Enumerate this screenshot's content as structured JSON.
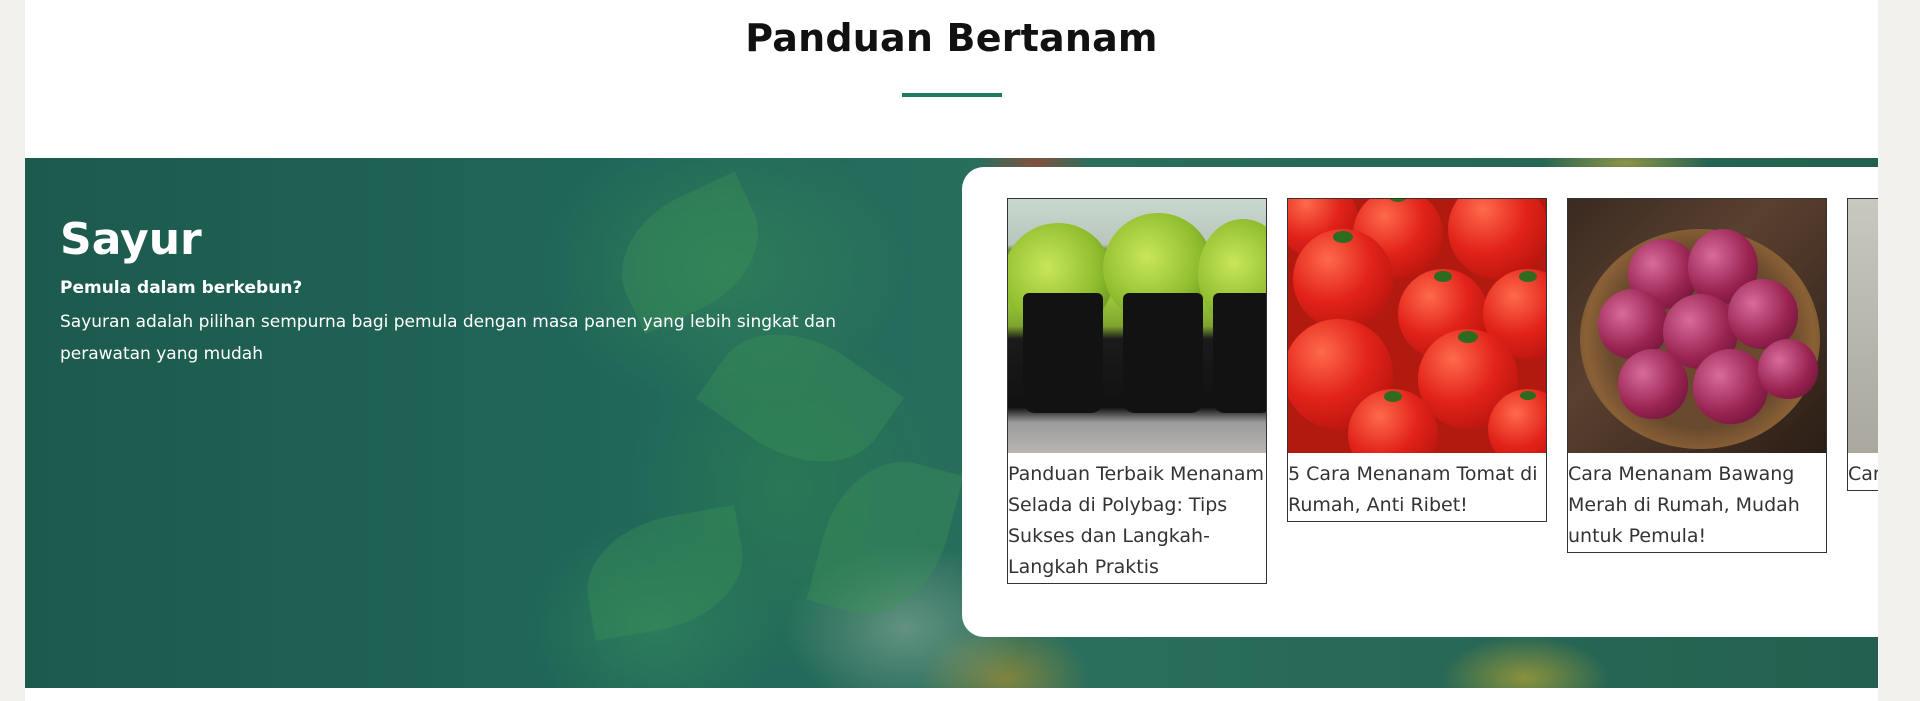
{
  "section": {
    "title": "Panduan Bertanam",
    "accent_color": "#1f7a63"
  },
  "hero": {
    "title": "Sayur",
    "subtitle": "Pemula dalam berkebun?",
    "description": "Sayuran adalah pilihan sempurna bagi pemula dengan masa panen yang lebih singkat dan perawatan yang mudah",
    "background_color": "#21685a"
  },
  "cards": [
    {
      "title": "Panduan Terbaik Menanam Selada di Polybag: Tips Sukses dan Langkah-Langkah Praktis",
      "image": "lettuce-polybag-photo"
    },
    {
      "title": "5 Cara Menanam Tomat di Rumah, Anti Ribet!",
      "image": "tomatoes-photo"
    },
    {
      "title": "Cara Menanam Bawang Merah di Rumah, Mudah untuk Pemula!",
      "image": "red-onions-basket-photo"
    },
    {
      "title": "Cara M",
      "image": "partial-card-photo"
    }
  ]
}
